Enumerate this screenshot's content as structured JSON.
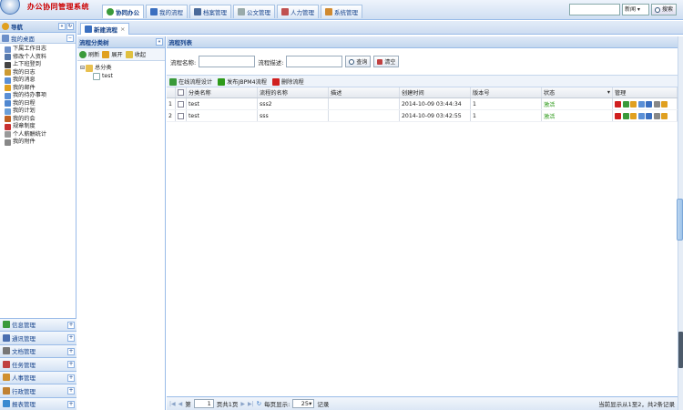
{
  "app": {
    "title": "办公协同管理系统"
  },
  "nav": {
    "tabs": [
      {
        "label": "协同办公",
        "icon": "globe-icon",
        "active": true
      },
      {
        "label": "我的流程",
        "icon": "flow-icon"
      },
      {
        "label": "档案管理",
        "icon": "archive-icon"
      },
      {
        "label": "公文管理",
        "icon": "document-icon"
      },
      {
        "label": "人力管理",
        "icon": "people-icon"
      },
      {
        "label": "系统管理",
        "icon": "wrench-icon"
      }
    ]
  },
  "search": {
    "placeholder": "",
    "scope": "新闻",
    "button": "搜索"
  },
  "sidebar": {
    "title": "导航",
    "desk": {
      "title": "我的桌面",
      "items": [
        {
          "label": "下属工作日志",
          "color": "#6b8fc9"
        },
        {
          "label": "修改个人资料",
          "color": "#5577aa"
        },
        {
          "label": "上下班登到",
          "color": "#444444"
        },
        {
          "label": "我的日志",
          "color": "#cc9a33"
        },
        {
          "label": "我的消息",
          "color": "#5a8fd6"
        },
        {
          "label": "我的邮件",
          "color": "#e0a020"
        },
        {
          "label": "我的待办事项",
          "color": "#5a8fd6"
        },
        {
          "label": "我的日程",
          "color": "#4f87d0"
        },
        {
          "label": "我的计划",
          "color": "#6a9fd8"
        },
        {
          "label": "我的约会",
          "color": "#c06020"
        },
        {
          "label": "规章制度",
          "color": "#c83030"
        },
        {
          "label": "个人薪酬统计",
          "color": "#999999"
        },
        {
          "label": "我的附件",
          "color": "#888888"
        }
      ]
    },
    "accordion": [
      {
        "label": "信息管理",
        "color": "#3a9a3a"
      },
      {
        "label": "通讯管理",
        "color": "#4a6fb0"
      },
      {
        "label": "文档管理",
        "color": "#777777"
      },
      {
        "label": "任务管理",
        "color": "#c04040"
      },
      {
        "label": "人事管理",
        "color": "#d09030"
      },
      {
        "label": "行政管理",
        "color": "#c08030"
      },
      {
        "label": "报表管理",
        "color": "#3a8ad0"
      }
    ]
  },
  "content_tab": {
    "label": "新建流程",
    "close": "×"
  },
  "category_panel": {
    "title": "流程分类树",
    "toolbar": {
      "refresh": "刷新",
      "expand": "展开",
      "collapse": "收起"
    },
    "tree": {
      "root": "总分类",
      "child": "test"
    }
  },
  "list_panel": {
    "title": "流程列表",
    "form": {
      "name_label": "流程名称:",
      "desc_label": "流程描述:",
      "query": "查询",
      "clear": "清空"
    },
    "toolbar": {
      "design": "在线流程设计",
      "publish": "发布JBPM4流程",
      "delete": "删除流程"
    },
    "columns": {
      "category": "分类名称",
      "name": "流程的名称",
      "desc": "描述",
      "created": "创建时间",
      "version": "版本号",
      "status": "状态",
      "manage": "管理"
    },
    "rows": [
      {
        "num": "1",
        "category": "test",
        "name": "sss2",
        "desc": "",
        "created": "2014-10-09 03:44:34",
        "version": "1",
        "status": "激活"
      },
      {
        "num": "2",
        "category": "test",
        "name": "sss",
        "desc": "",
        "created": "2014-10-09 03:42:55",
        "version": "1",
        "status": "激活"
      }
    ],
    "pager": {
      "page_prefix": "第",
      "page": "1",
      "page_suffix": "页共1页",
      "per_page_label": "每页显示:",
      "per_page": "25",
      "records": "记录",
      "summary": "当前显示从1至2，共2条记录"
    }
  },
  "colors": {
    "border": "#99bbe8",
    "title": "#15428b",
    "active": "#2e9a1a"
  }
}
